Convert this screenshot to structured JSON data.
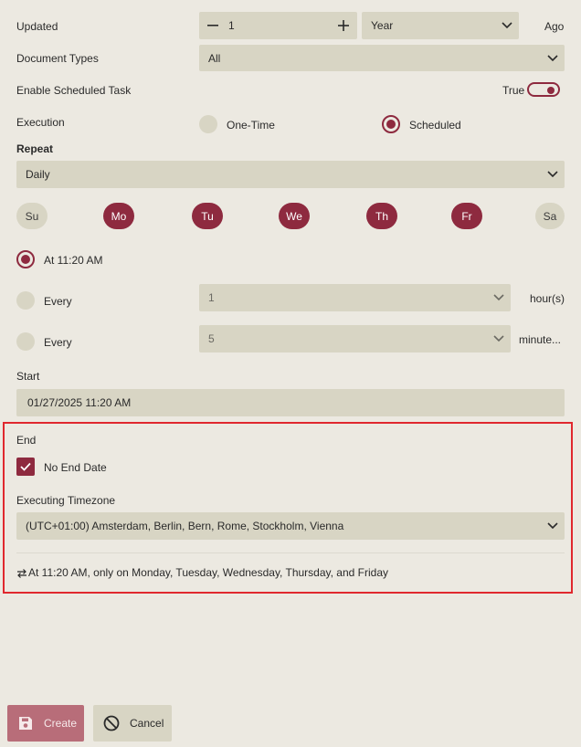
{
  "form": {
    "updated": {
      "label": "Updated",
      "value": "1",
      "unit": "Year",
      "suffix": "Ago"
    },
    "document_types": {
      "label": "Document Types",
      "value": "All"
    },
    "enable_scheduled_task": {
      "label": "Enable Scheduled Task",
      "value_label": "True",
      "on": true
    },
    "execution": {
      "label": "Execution",
      "options": [
        {
          "label": "One-Time",
          "selected": false
        },
        {
          "label": "Scheduled",
          "selected": true
        }
      ]
    },
    "repeat": {
      "label": "Repeat",
      "value": "Daily",
      "days": [
        {
          "label": "Su",
          "selected": false
        },
        {
          "label": "Mo",
          "selected": true
        },
        {
          "label": "Tu",
          "selected": true
        },
        {
          "label": "We",
          "selected": true
        },
        {
          "label": "Th",
          "selected": true
        },
        {
          "label": "Fr",
          "selected": true
        },
        {
          "label": "Sa",
          "selected": false
        }
      ]
    },
    "time_options": {
      "at": {
        "label": "At 11:20 AM",
        "selected": true
      },
      "every_hours": {
        "label": "Every",
        "value": "1",
        "unit": "hour(s)",
        "selected": false
      },
      "every_minutes": {
        "label": "Every",
        "value": "5",
        "unit": "minute...",
        "selected": false
      }
    },
    "start": {
      "label": "Start",
      "value": "01/27/2025 11:20 AM"
    },
    "end": {
      "label": "End",
      "no_end_date": {
        "label": "No End Date",
        "checked": true
      }
    },
    "timezone": {
      "label": "Executing Timezone",
      "value": "(UTC+01:00) Amsterdam, Berlin, Bern, Rome, Stockholm, Vienna"
    },
    "summary": "At 11:20 AM, only on Monday, Tuesday, Wednesday, Thursday, and Friday"
  },
  "actions": {
    "create_label": "Create",
    "cancel_label": "Cancel"
  },
  "colors": {
    "accent": "#8e2a3f",
    "field_bg": "#d8d5c4",
    "page_bg": "#ece9e1",
    "highlight": "#e0282e"
  }
}
